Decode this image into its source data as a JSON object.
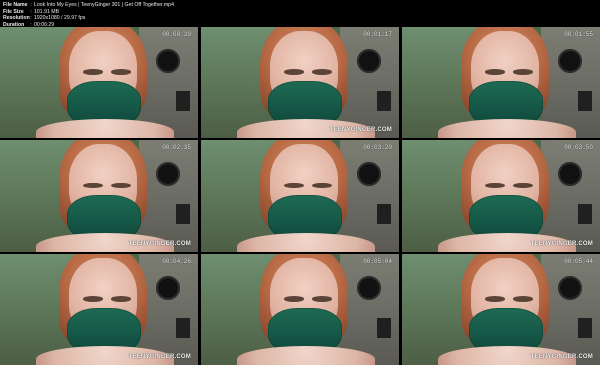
{
  "header": {
    "file_name_label": "File Name",
    "file_name_value": "Look Into My Eyes  |  TeenyGinger 301  |  Get Off Together.mp4",
    "file_size_label": "File Size",
    "file_size_value": "101.91 MB",
    "resolution_label": "Resolution",
    "resolution_value": "1920x1080 / 29.97 fps",
    "duration_label": "Duration",
    "duration_value": "00:06:29"
  },
  "thumbnails": [
    {
      "time": "00:00:39",
      "watermark": ""
    },
    {
      "time": "00:01:17",
      "watermark": "TEENYGINGER.COM"
    },
    {
      "time": "00:01:55",
      "watermark": ""
    },
    {
      "time": "00:02:35",
      "watermark": "TEENYGINGER.COM"
    },
    {
      "time": "00:03:20",
      "watermark": ""
    },
    {
      "time": "00:03:50",
      "watermark": "TEENYGINGER.COM"
    },
    {
      "time": "00:04:26",
      "watermark": "TEENYGINGER.COM"
    },
    {
      "time": "00:05:04",
      "watermark": ""
    },
    {
      "time": "00:05:44",
      "watermark": "TEENYGINGER.COM"
    }
  ]
}
